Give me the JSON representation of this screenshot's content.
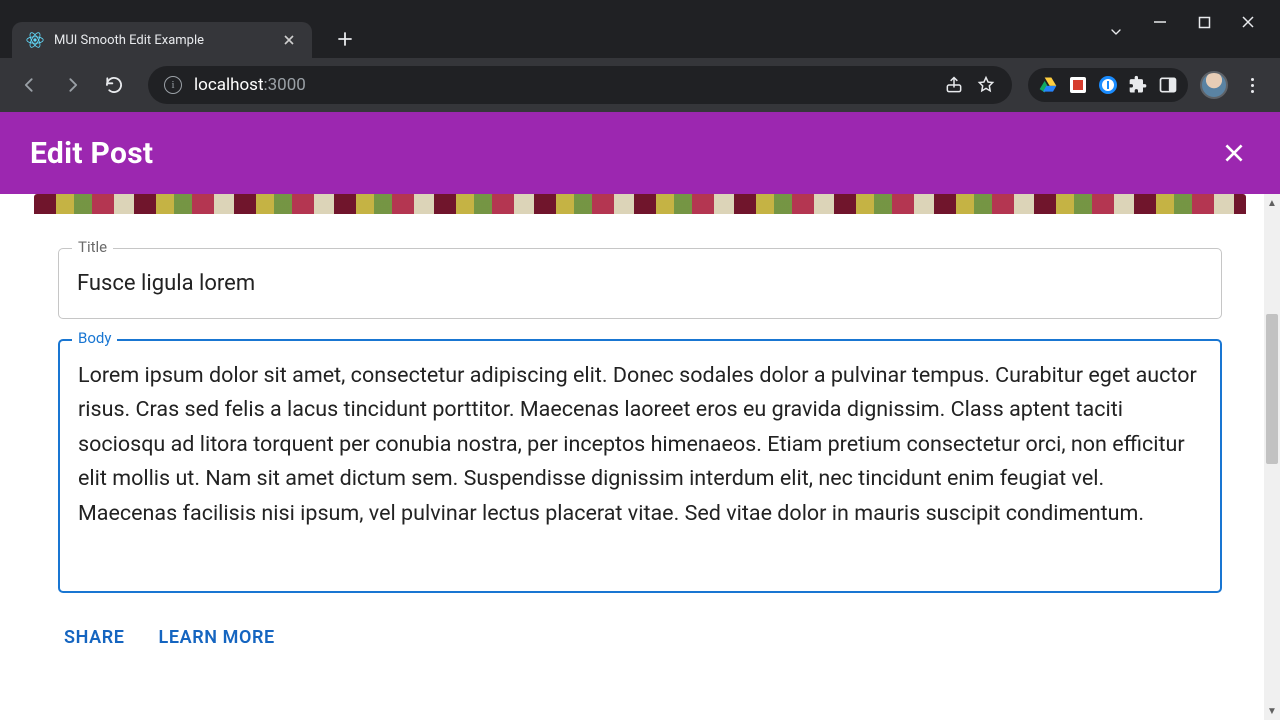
{
  "browser": {
    "tab": {
      "title": "MUI Smooth Edit Example"
    },
    "url": {
      "host": "localhost",
      "port": ":3000"
    }
  },
  "appbar": {
    "title": "Edit Post"
  },
  "form": {
    "title_label": "Title",
    "title_value": "Fusce ligula lorem",
    "body_label": "Body",
    "body_value": "Lorem ipsum dolor sit amet, consectetur adipiscing elit. Donec sodales dolor a pulvinar tempus. Curabitur eget auctor risus. Cras sed felis a lacus tincidunt porttitor. Maecenas laoreet eros eu gravida dignissim. Class aptent taciti sociosqu ad litora torquent per conubia nostra, per inceptos himenaeos. Etiam pretium consectetur orci, non efficitur elit mollis ut. Nam sit amet dictum sem. Suspendisse dignissim interdum elit, nec tincidunt enim feugiat vel. Maecenas facilisis nisi ipsum, vel pulvinar lectus placerat vitae. Sed vitae dolor in mauris suscipit condimentum."
  },
  "actions": {
    "share": "SHARE",
    "learn_more": "LEARN MORE"
  }
}
